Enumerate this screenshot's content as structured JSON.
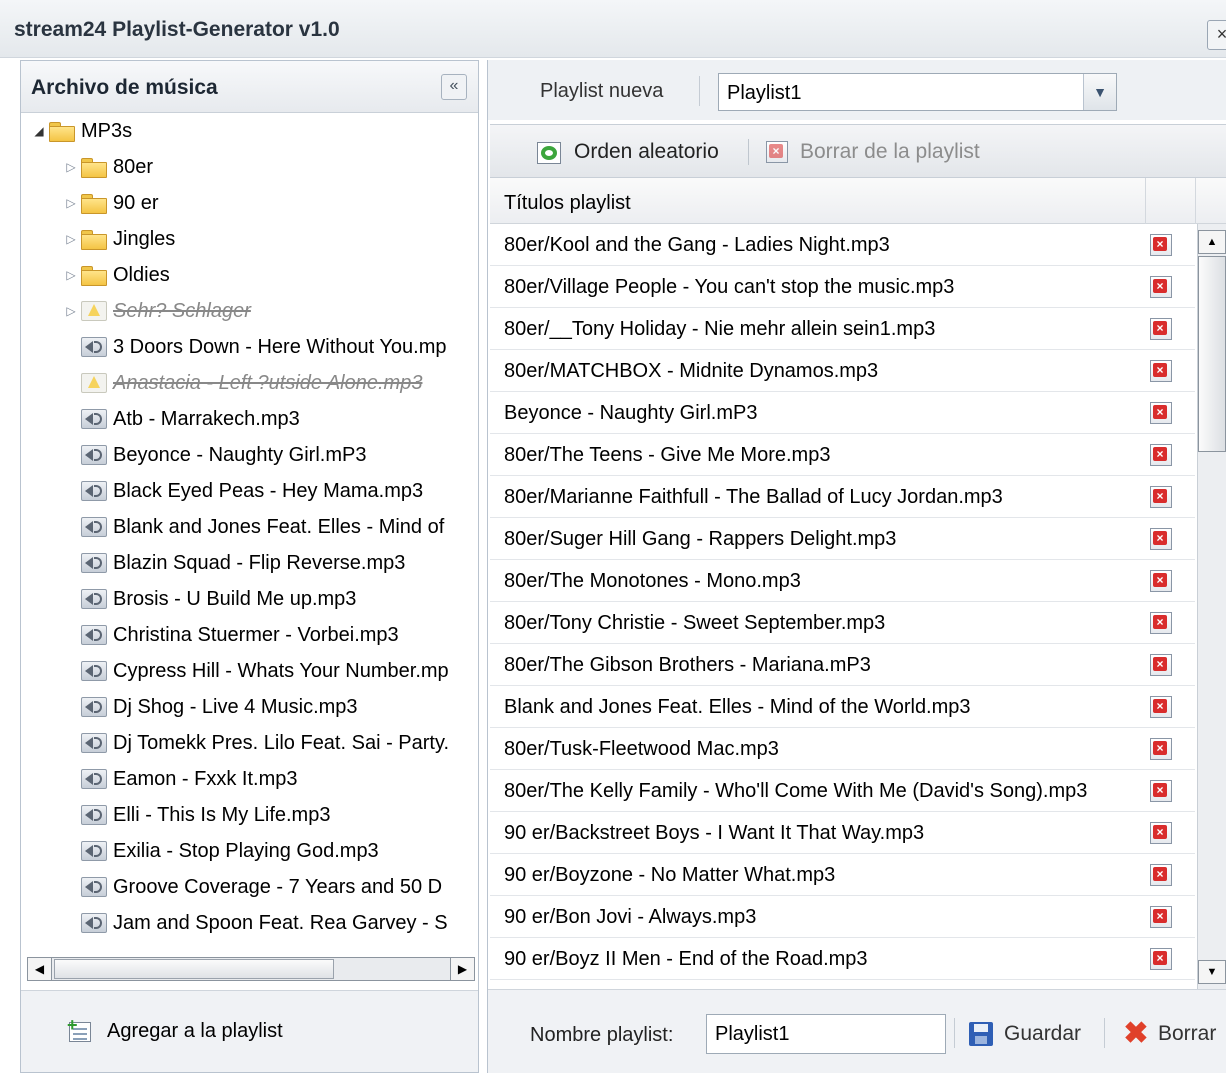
{
  "window": {
    "title": "stream24 Playlist-Generator v1.0",
    "close_glyph": "×"
  },
  "left": {
    "title": "Archivo de música",
    "collapse_glyph": "«",
    "tree": [
      {
        "label": "MP3s",
        "kind": "folder",
        "expanded": true,
        "depth": 0
      },
      {
        "label": "80er",
        "kind": "folder",
        "expanded": false,
        "depth": 1
      },
      {
        "label": "90 er",
        "kind": "folder",
        "expanded": false,
        "depth": 1
      },
      {
        "label": "Jingles",
        "kind": "folder",
        "expanded": false,
        "depth": 1
      },
      {
        "label": "Oldies",
        "kind": "folder",
        "expanded": false,
        "depth": 1
      },
      {
        "label": "Sehr? Schlager",
        "kind": "warning-folder",
        "expanded": false,
        "depth": 1
      },
      {
        "label": "3 Doors Down - Here Without You.mp",
        "kind": "file",
        "depth": 1
      },
      {
        "label": "Anastacia - Left ?utside Alone.mp3",
        "kind": "warning-file",
        "depth": 1
      },
      {
        "label": "Atb - Marrakech.mp3",
        "kind": "file",
        "depth": 1
      },
      {
        "label": "Beyonce - Naughty Girl.mP3",
        "kind": "file",
        "depth": 1
      },
      {
        "label": "Black Eyed Peas - Hey Mama.mp3",
        "kind": "file",
        "depth": 1
      },
      {
        "label": "Blank and Jones Feat. Elles - Mind of",
        "kind": "file",
        "depth": 1
      },
      {
        "label": "Blazin Squad - Flip Reverse.mp3",
        "kind": "file",
        "depth": 1
      },
      {
        "label": "Brosis - U Build Me up.mp3",
        "kind": "file",
        "depth": 1
      },
      {
        "label": "Christina Stuermer - Vorbei.mp3",
        "kind": "file",
        "depth": 1
      },
      {
        "label": "Cypress Hill - Whats Your Number.mp",
        "kind": "file",
        "depth": 1
      },
      {
        "label": "Dj Shog - Live 4 Music.mp3",
        "kind": "file",
        "depth": 1
      },
      {
        "label": "Dj Tomekk Pres. Lilo Feat. Sai - Party.",
        "kind": "file",
        "depth": 1
      },
      {
        "label": "Eamon - Fxxk It.mp3",
        "kind": "file",
        "depth": 1
      },
      {
        "label": "Elli - This Is My Life.mp3",
        "kind": "file",
        "depth": 1
      },
      {
        "label": "Exilia - Stop Playing God.mp3",
        "kind": "file",
        "depth": 1
      },
      {
        "label": "Groove Coverage - 7 Years and 50 D",
        "kind": "file",
        "depth": 1
      },
      {
        "label": "Jam and Spoon Feat. Rea Garvey - S",
        "kind": "file",
        "depth": 1
      }
    ],
    "scroll_left_glyph": "◀",
    "scroll_right_glyph": "▶",
    "add_label": "Agregar a la playlist"
  },
  "right": {
    "new_label": "Playlist nueva",
    "select_value": "Playlist1",
    "select_glyph": "▼",
    "shuffle_label": "Orden aleatorio",
    "remove_label": "Borrar de la playlist",
    "column_title": "Títulos playlist",
    "rows": [
      "80er/Kool and the Gang - Ladies Night.mp3",
      "80er/Village People - You can't stop the music.mp3",
      "80er/__Tony Holiday - Nie mehr allein sein1.mp3",
      "80er/MATCHBOX - Midnite Dynamos.mp3",
      "Beyonce - Naughty Girl.mP3",
      "80er/The Teens - Give Me More.mp3",
      "80er/Marianne Faithfull - The Ballad of Lucy Jordan.mp3",
      "80er/Suger Hill Gang - Rappers Delight.mp3",
      "80er/The Monotones - Mono.mp3",
      "80er/Tony Christie - Sweet September.mp3",
      "80er/The Gibson Brothers - Mariana.mP3",
      "Blank and Jones Feat. Elles - Mind of the World.mp3",
      "80er/Tusk-Fleetwood Mac.mp3",
      "80er/The Kelly Family - Who'll Come With Me (David's Song).mp3",
      "90 er/Backstreet Boys - I Want It That Way.mp3",
      "90 er/Boyzone - No Matter What.mp3",
      "90 er/Bon Jovi - Always.mp3",
      "90 er/Boyz II Men - End of the Road.mp3"
    ],
    "scroll_up_glyph": "▲",
    "scroll_down_glyph": "▼",
    "name_label": "Nombre playlist:",
    "name_value": "Playlist1",
    "save_label": "Guardar",
    "clear_label": "Borrar",
    "clear_glyph": "✖"
  },
  "colors": {
    "accent_red": "#d92c2c",
    "header_bg": "#e4e8ec",
    "folder_yellow": "#f4c445"
  }
}
